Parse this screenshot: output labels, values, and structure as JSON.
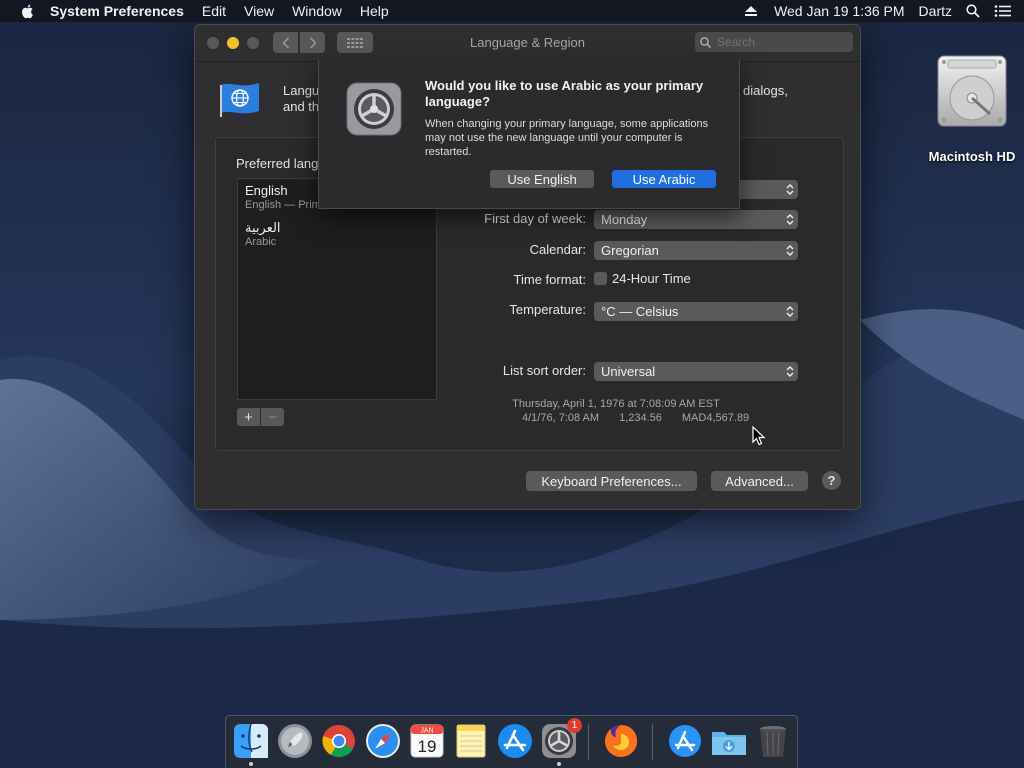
{
  "menubar": {
    "app_name": "System Preferences",
    "items": [
      "Edit",
      "View",
      "Window",
      "Help"
    ],
    "datetime": "Wed Jan 19  1:36 PM",
    "user": "Dartz"
  },
  "desktop": {
    "hd_label": "Macintosh HD"
  },
  "window": {
    "title": "Language & Region",
    "search_placeholder": "Search",
    "header_text_visible": "Langu",
    "header_text_line2": "and th",
    "header_text_tail": "dialogs,",
    "preferred_title": "Preferred lang",
    "languages": [
      {
        "name": "English",
        "sub": "English — Prim"
      },
      {
        "name": "العربية",
        "sub": "Arabic"
      }
    ],
    "settings": {
      "first_day_label": "First day of week:",
      "first_day_value": "Monday",
      "calendar_label": "Calendar:",
      "calendar_value": "Gregorian",
      "time_format_label": "Time format:",
      "time_format_option": "24-Hour Time",
      "temperature_label": "Temperature:",
      "temperature_value": "°C — Celsius",
      "sort_label": "List sort order:",
      "sort_value": "Universal"
    },
    "samples": {
      "line1": "Thursday, April 1, 1976 at 7:08:09 AM EST",
      "date": "4/1/76, 7:08 AM",
      "number": "1,234.56",
      "currency": "MAD4,567.89"
    },
    "buttons": {
      "keyboard": "Keyboard Preferences...",
      "advanced": "Advanced...",
      "help": "?",
      "add": "+",
      "remove": "−"
    }
  },
  "sheet": {
    "title": "Would you like to use Arabic as your primary language?",
    "message": "When changing your primary language, some applications may not use the new language until your computer is restarted.",
    "secondary_button": "Use English",
    "primary_button": "Use Arabic"
  },
  "dock": {
    "calendar_month": "JAN",
    "calendar_day": "19",
    "badge_count": "1",
    "items": [
      "finder-icon",
      "launchpad-icon",
      "chrome-icon",
      "safari-icon",
      "calendar-icon",
      "notes-icon",
      "app-store-icon",
      "system-preferences-icon",
      "firefox-icon",
      "applications-folder-icon",
      "downloads-folder-icon",
      "trash-icon"
    ]
  },
  "colors": {
    "accent": "#1f6fe0",
    "window_bg": "#2f2f31",
    "minimize": "#f5bf2e"
  }
}
